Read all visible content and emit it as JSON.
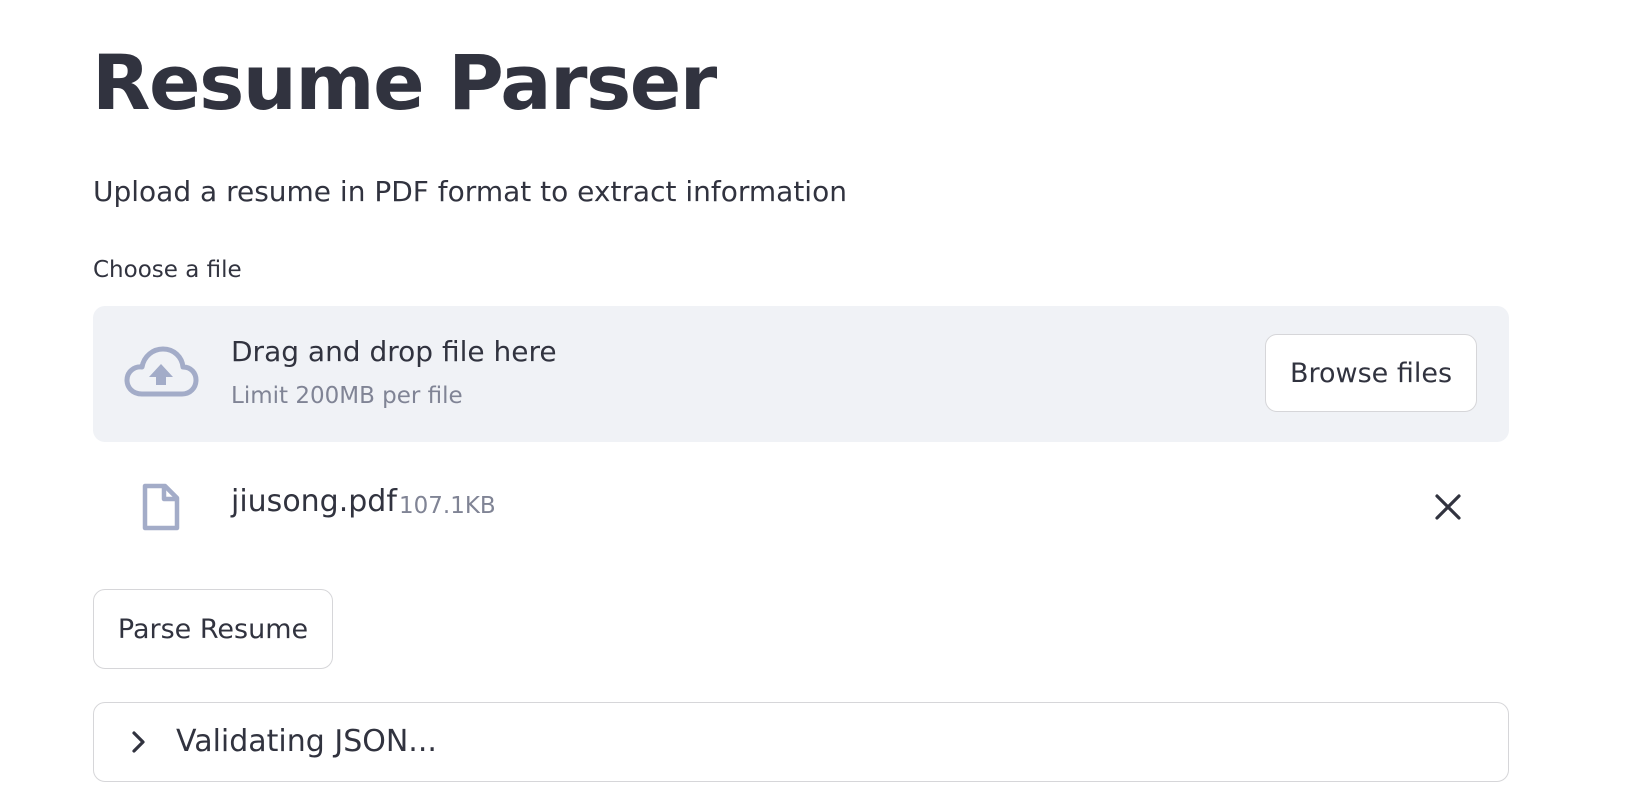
{
  "page": {
    "title": "Resume Parser",
    "subtitle": "Upload a resume in PDF format to extract information"
  },
  "uploader": {
    "label": "Choose a file",
    "drop_text": "Drag and drop file here",
    "limit_text": "Limit 200MB per file",
    "browse_label": "Browse files",
    "icon": "cloud-upload-icon"
  },
  "uploaded_file": {
    "name": "jiusong.pdf",
    "size": "107.1KB",
    "icon": "file-icon",
    "remove_icon": "close-icon"
  },
  "actions": {
    "parse_label": "Parse Resume"
  },
  "status": {
    "expander_label": "Validating JSON...",
    "expander_icon": "chevron-right-icon"
  },
  "colors": {
    "text": "#31333f",
    "muted_text": "#808495",
    "dropzone_bg": "#f0f2f6",
    "icon_gray": "#a3acc8",
    "border": "#d6d6d9"
  }
}
